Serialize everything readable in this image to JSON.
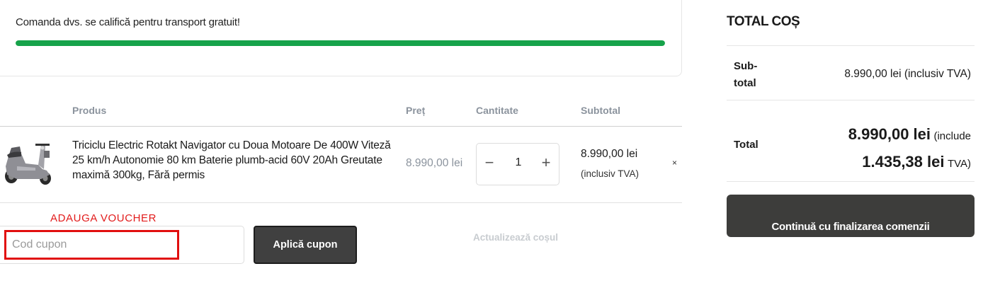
{
  "shipping": {
    "message": "Comanda dvs. se califică pentru transport gratuit!",
    "progress_percent": 100,
    "progress_color": "#16a34a"
  },
  "cart_table": {
    "headers": {
      "product": "Produs",
      "price": "Preț",
      "quantity": "Cantitate",
      "subtotal": "Subtotal"
    },
    "items": [
      {
        "image_icon": "electric-tricycle-image",
        "name": "Triciclu Electric Rotakt Navigator cu Doua Motoare De 400W Viteză 25 km/h Autonomie 80 km Baterie plumb-acid 60V 20Ah Greutate maximă 300kg, Fără permis",
        "price": "8.990,00 lei",
        "quantity": "1",
        "subtotal": "8.990,00 lei",
        "subtotal_tax_note": "(inclusiv TVA)",
        "remove": "×"
      }
    ]
  },
  "coupon": {
    "annotation": "ADAUGA VOUCHER",
    "placeholder": "Cod cupon",
    "apply_label": "Aplică cupon",
    "annotation_color": "#e10f0f"
  },
  "update_cart_label": "Actualizează coșul",
  "totals": {
    "title": "TOTAL COȘ",
    "subtotal_label": "Sub-total",
    "subtotal_value": "8.990,00 lei (inclusiv TVA)",
    "total_label": "Total",
    "total_value": "8.990,00 lei",
    "total_include": "(include",
    "tax_value": "1.435,38 lei",
    "tax_suffix": "TVA)",
    "checkout_label": "Continuă cu finalizarea comenzii"
  }
}
